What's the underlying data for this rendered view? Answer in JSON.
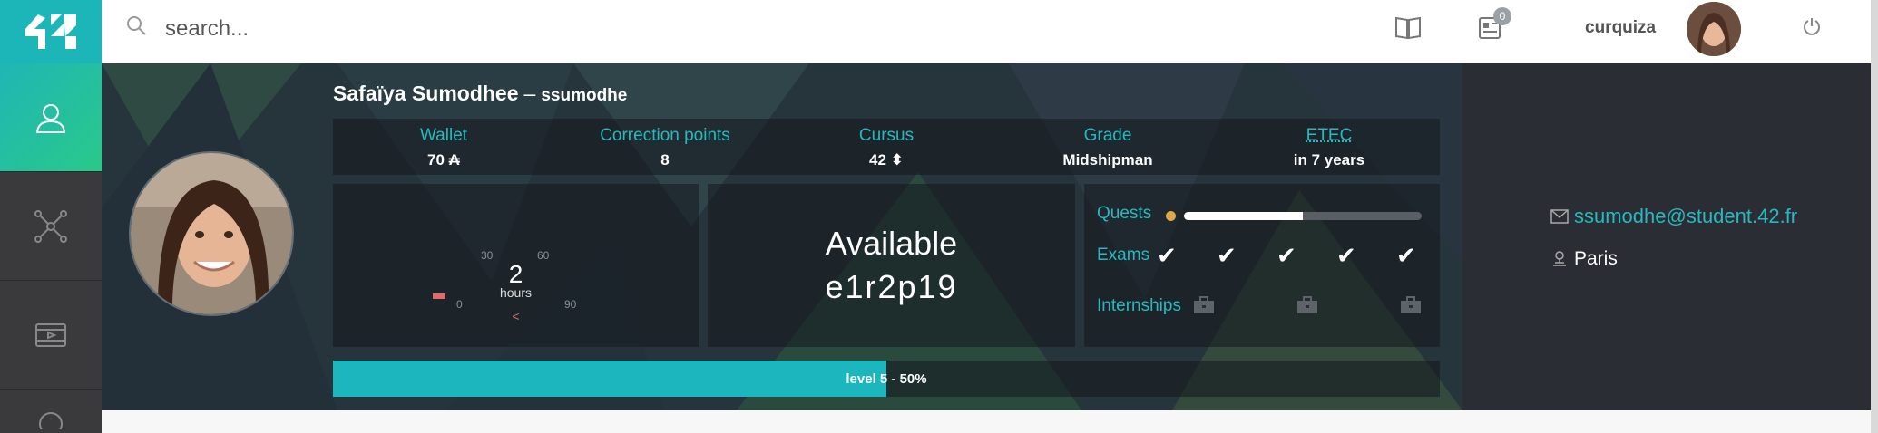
{
  "app": {
    "logo_text": "42"
  },
  "search": {
    "placeholder": "search..."
  },
  "header": {
    "username": "curquiza",
    "notification_count": "0"
  },
  "profile": {
    "name": "Safaïya Sumodhee",
    "separator": "–",
    "login": "ssumodhe",
    "stats": [
      {
        "label": "Wallet",
        "value": "70 ₳"
      },
      {
        "label": "Correction points",
        "value": "8"
      },
      {
        "label": "Cursus",
        "value": "42 ⬍"
      },
      {
        "label": "Grade",
        "value": "Midshipman"
      },
      {
        "label": "ETEC",
        "value": "in 7 years"
      }
    ],
    "logtime": {
      "value": "2",
      "unit": "hours",
      "ticks": [
        "30",
        "60",
        "0",
        "90"
      ],
      "arrow": "<"
    },
    "availability": {
      "status": "Available",
      "host": "e1r2p19"
    },
    "progress": {
      "quests_label": "Quests",
      "quests_fraction": 0.5,
      "exams_label": "Exams",
      "exam_checks": [
        "✔",
        "✔",
        "✔",
        "✔",
        "✔"
      ],
      "internships_label": "Internships"
    },
    "level": {
      "text": "level 5 - 50%",
      "fraction": 0.5
    },
    "email": "ssumodhe@student.42.fr",
    "location": "Paris"
  },
  "colors": {
    "accent": "#1cb6b9",
    "banner_bg": "#26343b",
    "sidebar_bg": "#3a3a3d",
    "side_panel_bg": "#2b2d34",
    "quest_dot": "#e0a84a"
  }
}
